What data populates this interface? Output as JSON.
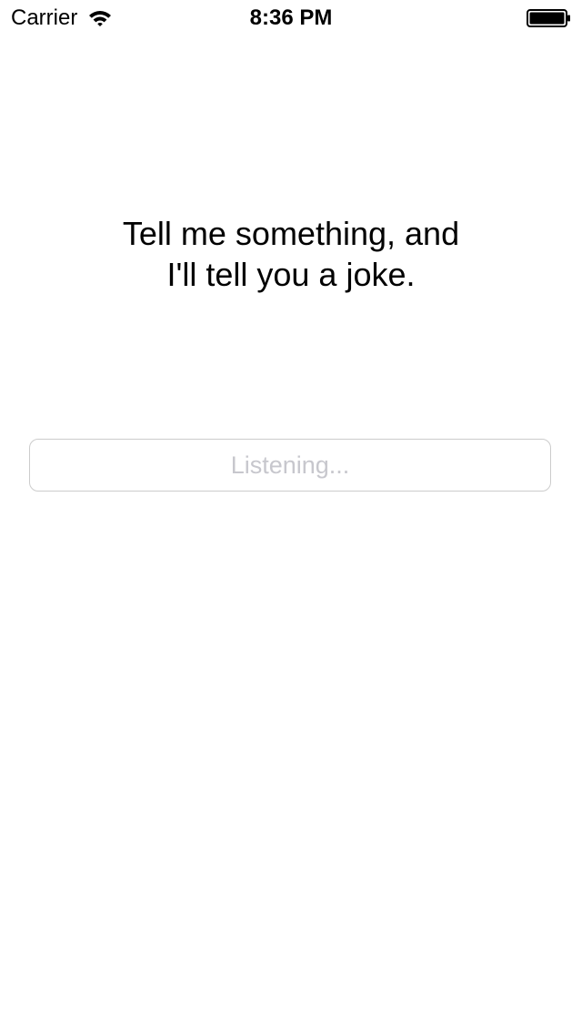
{
  "status_bar": {
    "carrier": "Carrier",
    "time": "8:36 PM",
    "wifi_icon": "wifi-icon",
    "battery_icon": "battery-icon"
  },
  "main": {
    "prompt_line1": "Tell me something, and",
    "prompt_line2": "I'll tell you a joke.",
    "speech_field": {
      "value": "",
      "placeholder": "Listening..."
    }
  },
  "colors": {
    "background": "#ffffff",
    "text": "#000000",
    "placeholder": "#c7c7cd",
    "field_border": "#cccccc"
  }
}
